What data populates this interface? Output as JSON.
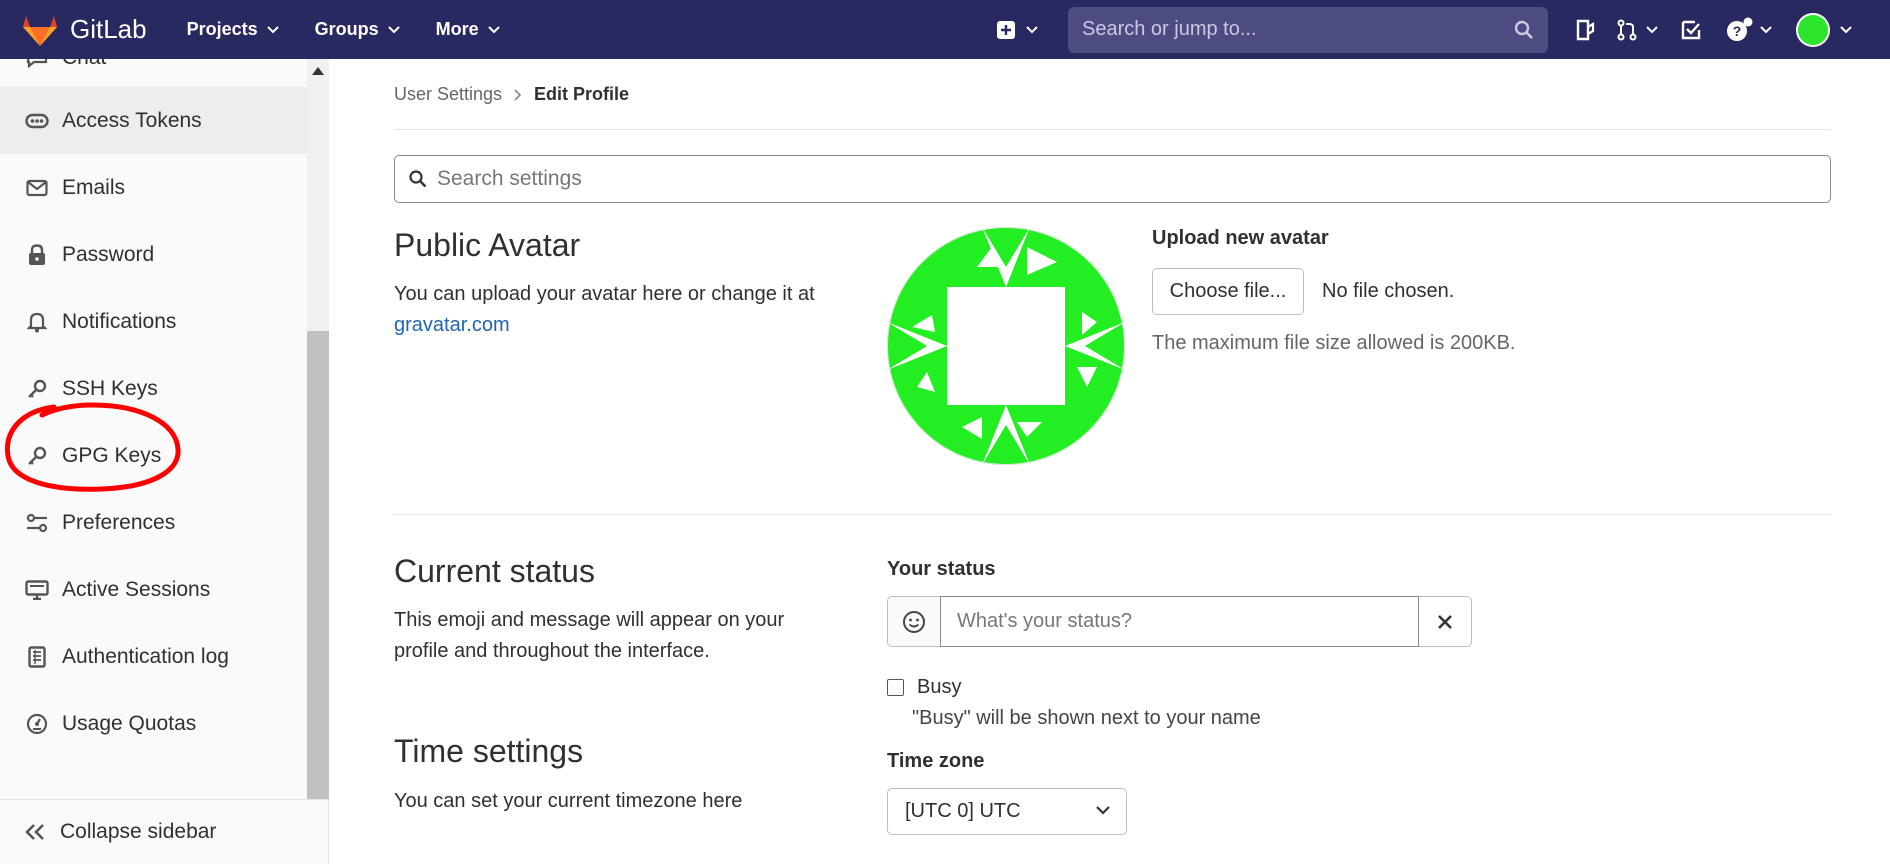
{
  "navbar": {
    "brand_name": "GitLab",
    "menu": [
      {
        "label": "Projects"
      },
      {
        "label": "Groups"
      },
      {
        "label": "More"
      }
    ],
    "search_placeholder": "Search or jump to...",
    "bg_color": "#292961"
  },
  "sidebar": {
    "items": [
      {
        "label": "Chat",
        "icon": "chat-icon"
      },
      {
        "label": "Access Tokens",
        "icon": "token-icon",
        "active": true
      },
      {
        "label": "Emails",
        "icon": "mail-icon"
      },
      {
        "label": "Password",
        "icon": "lock-icon"
      },
      {
        "label": "Notifications",
        "icon": "bell-icon"
      },
      {
        "label": "SSH Keys",
        "icon": "key-icon"
      },
      {
        "label": "GPG Keys",
        "icon": "key-icon"
      },
      {
        "label": "Preferences",
        "icon": "settings-sliders-icon"
      },
      {
        "label": "Active Sessions",
        "icon": "monitor-icon"
      },
      {
        "label": "Authentication log",
        "icon": "log-icon"
      },
      {
        "label": "Usage Quotas",
        "icon": "quota-icon"
      }
    ],
    "collapse_label": "Collapse sidebar",
    "annotation_color": "#ff0000"
  },
  "breadcrumb": {
    "parent": "User Settings",
    "current": "Edit Profile"
  },
  "settings_search": {
    "placeholder": "Search settings"
  },
  "avatar_section": {
    "title": "Public Avatar",
    "description": "You can upload your avatar here or change it at",
    "link_text": "gravatar.com",
    "upload_label": "Upload new avatar",
    "choose_button": "Choose file...",
    "no_file_text": "No file chosen.",
    "max_size_text": "The maximum file size allowed is 200KB.",
    "avatar_color": "#22ee22"
  },
  "status_section": {
    "title": "Current status",
    "description": "This emoji and message will appear on your profile and throughout the interface.",
    "your_status_label": "Your status",
    "status_placeholder": "What's your status?",
    "busy_label": "Busy",
    "busy_help": "\"Busy\" will be shown next to your name"
  },
  "time_section": {
    "title": "Time settings",
    "description": "You can set your current timezone here",
    "timezone_label": "Time zone",
    "timezone_value": "[UTC 0] UTC"
  }
}
